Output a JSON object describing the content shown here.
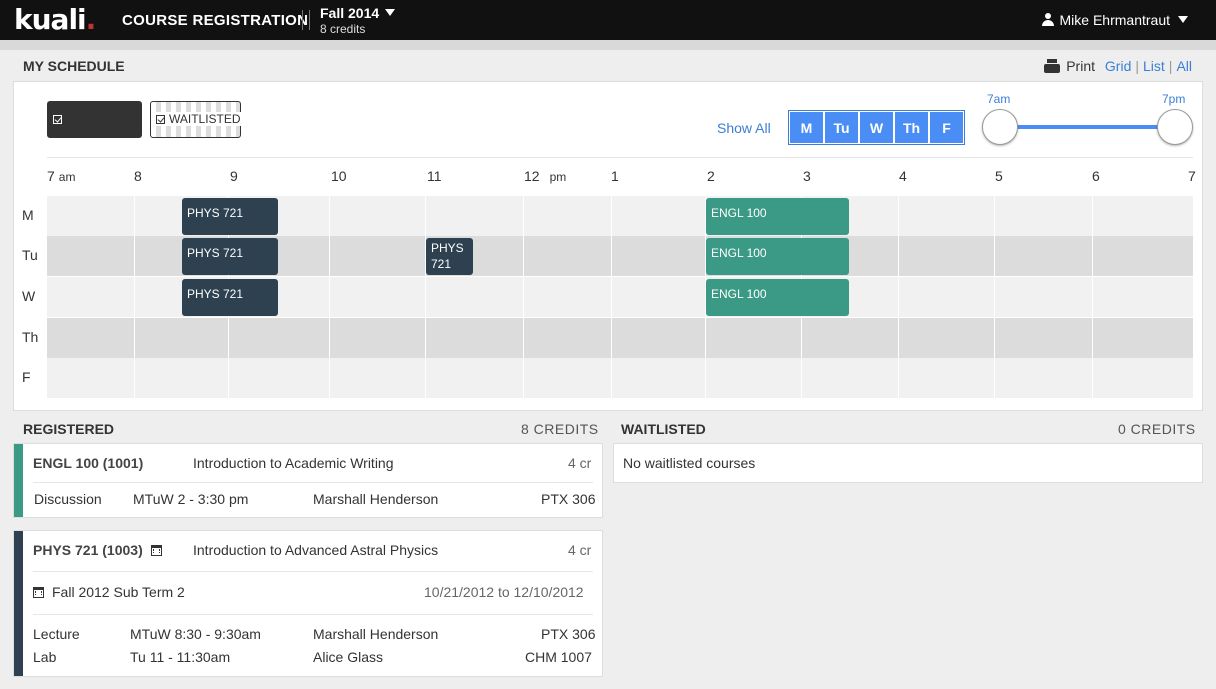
{
  "topbar": {
    "logo": "kuali",
    "app_title": "COURSE REGISTRATION",
    "term": "Fall 2014",
    "term_credits": "8 credits",
    "user": "Mike Ehrmantraut"
  },
  "header": {
    "title": "MY SCHEDULE",
    "print": "Print",
    "views": [
      "Grid",
      "List",
      "All"
    ]
  },
  "legend": {
    "registered": "REGISTERED",
    "waitlisted": "WAITLISTED"
  },
  "filters": {
    "show_all": "Show All",
    "days": [
      "M",
      "Tu",
      "W",
      "Th",
      "F"
    ],
    "slider_start": "7am",
    "slider_end": "7pm"
  },
  "grid": {
    "hours": [
      "7",
      "8",
      "9",
      "10",
      "11",
      "12",
      "1",
      "2",
      "3",
      "4",
      "5",
      "6",
      "7"
    ],
    "am_suffix": "am",
    "pm_suffix": "pm",
    "day_labels": [
      "M",
      "Tu",
      "W",
      "Th",
      "F"
    ],
    "events": [
      {
        "day": "M",
        "label": "PHYS 721",
        "start": "8:30",
        "end": "9:30",
        "type": "registered"
      },
      {
        "day": "Tu",
        "label": "PHYS 721",
        "start": "8:30",
        "end": "9:30",
        "type": "registered"
      },
      {
        "day": "W",
        "label": "PHYS 721",
        "start": "8:30",
        "end": "9:30",
        "type": "registered"
      },
      {
        "day": "Tu",
        "label": "PHYS 721",
        "start": "11:00",
        "end": "11:30",
        "type": "registered"
      },
      {
        "day": "M",
        "label": "ENGL 100",
        "start": "14:00",
        "end": "15:30",
        "type": "registered"
      },
      {
        "day": "Tu",
        "label": "ENGL 100",
        "start": "14:00",
        "end": "15:30",
        "type": "registered"
      },
      {
        "day": "W",
        "label": "ENGL 100",
        "start": "14:00",
        "end": "15:30",
        "type": "registered"
      }
    ],
    "colors": {
      "phys": "#2e4150",
      "engl": "#3a9a85"
    }
  },
  "registered": {
    "title": "REGISTERED",
    "credits": "8 CREDITS",
    "courses": [
      {
        "code": "ENGL 100 (1001)",
        "name": "Introduction to Academic Writing",
        "credits": "4 cr",
        "meetings": [
          {
            "type": "Discussion",
            "time": "MTuW 2 - 3:30 pm",
            "instructor": "Marshall Henderson",
            "room": "PTX 306"
          }
        ]
      },
      {
        "code": "PHYS 721 (1003)",
        "name": "Introduction to Advanced Astral Physics",
        "credits": "4 cr",
        "subterm": "Fall 2012 Sub Term 2",
        "subterm_dates": "10/21/2012 to 12/10/2012",
        "meetings": [
          {
            "type": "Lecture",
            "time": "MTuW 8:30 - 9:30am",
            "instructor": "Marshall Henderson",
            "room": "PTX 306"
          },
          {
            "type": "Lab",
            "time": "Tu 11 - 11:30am",
            "instructor": "Alice Glass",
            "room": "CHM 1007"
          }
        ]
      }
    ]
  },
  "waitlisted": {
    "title": "WAITLISTED",
    "credits": "0 CREDITS",
    "empty": "No waitlisted courses"
  }
}
